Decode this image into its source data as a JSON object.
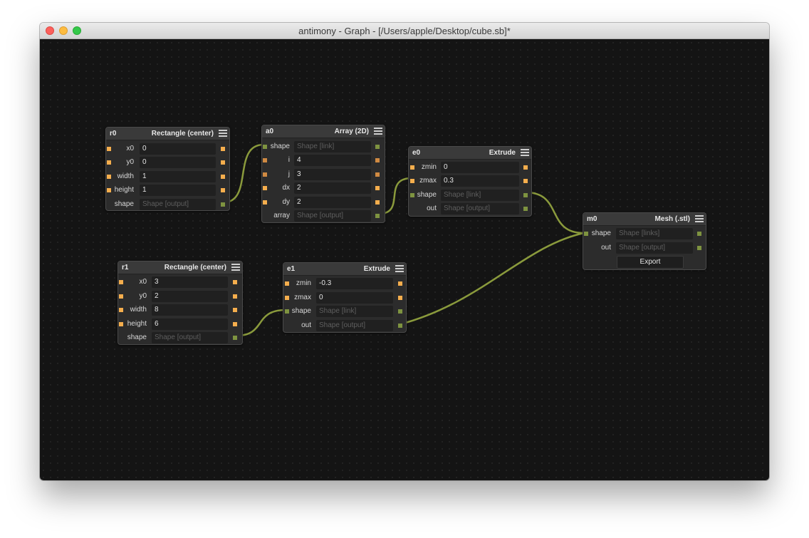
{
  "window": {
    "title": "antimony - Graph - [/Users/apple/Desktop/cube.sb]*"
  },
  "colors": {
    "canvas": "#141414",
    "wire": "#8a9a3c",
    "port_number": "#f5ae4d",
    "port_int": "#d08a42",
    "port_shape": "#7e9340"
  },
  "nodes": {
    "r0": {
      "name": "r0",
      "type": "Rectangle (center)",
      "rows": [
        {
          "label": "x0",
          "value": "0"
        },
        {
          "label": "y0",
          "value": "0"
        },
        {
          "label": "width",
          "value": "1"
        },
        {
          "label": "height",
          "value": "1"
        },
        {
          "label": "shape",
          "value": "Shape [output]"
        }
      ]
    },
    "a0": {
      "name": "a0",
      "type": "Array (2D)",
      "rows": [
        {
          "label": "shape",
          "value": "Shape [link]"
        },
        {
          "label": "i",
          "value": "4"
        },
        {
          "label": "j",
          "value": "3"
        },
        {
          "label": "dx",
          "value": "2"
        },
        {
          "label": "dy",
          "value": "2"
        },
        {
          "label": "array",
          "value": "Shape [output]"
        }
      ]
    },
    "e0": {
      "name": "e0",
      "type": "Extrude",
      "rows": [
        {
          "label": "zmin",
          "value": "0"
        },
        {
          "label": "zmax",
          "value": "0.3"
        },
        {
          "label": "shape",
          "value": "Shape [link]"
        },
        {
          "label": "out",
          "value": "Shape [output]"
        }
      ]
    },
    "m0": {
      "name": "m0",
      "type": "Mesh (.stl)",
      "rows": [
        {
          "label": "shape",
          "value": "Shape [links]"
        },
        {
          "label": "out",
          "value": "Shape [output]"
        }
      ],
      "button": "Export"
    },
    "r1": {
      "name": "r1",
      "type": "Rectangle (center)",
      "rows": [
        {
          "label": "x0",
          "value": "3"
        },
        {
          "label": "y0",
          "value": "2"
        },
        {
          "label": "width",
          "value": "8"
        },
        {
          "label": "height",
          "value": "6"
        },
        {
          "label": "shape",
          "value": "Shape [output]"
        }
      ]
    },
    "e1": {
      "name": "e1",
      "type": "Extrude",
      "rows": [
        {
          "label": "zmin",
          "value": "-0.3"
        },
        {
          "label": "zmax",
          "value": "0"
        },
        {
          "label": "shape",
          "value": "Shape [link]"
        },
        {
          "label": "out",
          "value": "Shape [output]"
        }
      ]
    }
  }
}
